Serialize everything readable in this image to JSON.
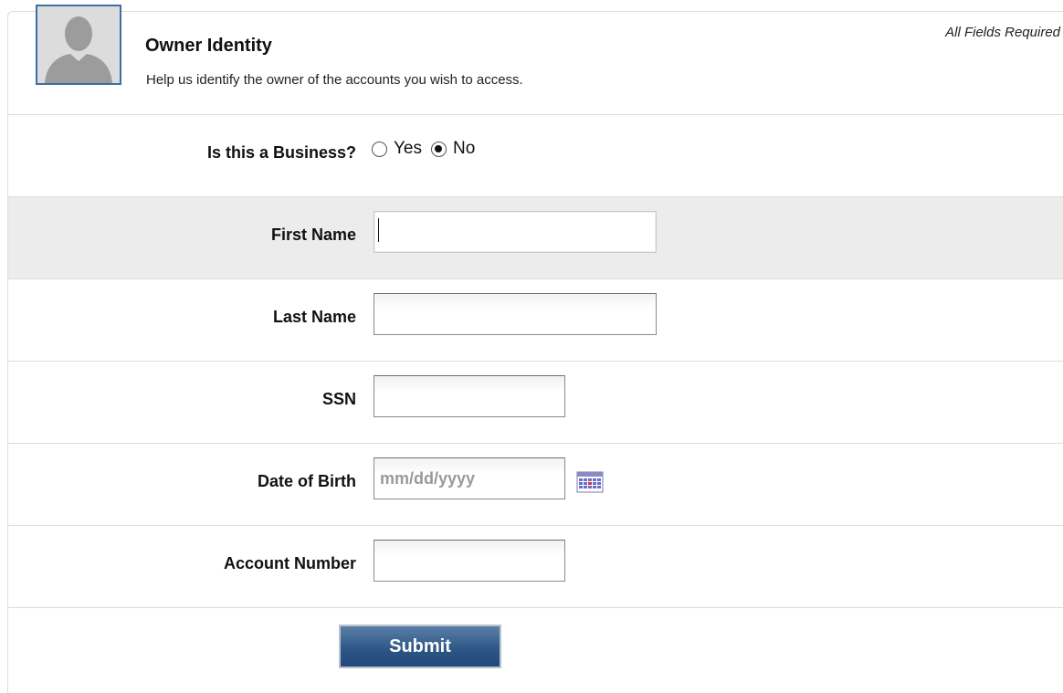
{
  "header": {
    "title": "Owner Identity",
    "subtitle": "Help us identify the owner of the accounts you wish to access.",
    "required_note": "All Fields Required",
    "avatar_icon": "user-silhouette-icon"
  },
  "business": {
    "label": "Is this a Business?",
    "options": [
      {
        "label": "Yes",
        "checked": false
      },
      {
        "label": "No",
        "checked": true
      }
    ]
  },
  "fields": {
    "first_name": {
      "label": "First Name",
      "value": "",
      "placeholder": ""
    },
    "last_name": {
      "label": "Last Name",
      "value": "",
      "placeholder": ""
    },
    "ssn": {
      "label": "SSN",
      "value": "",
      "placeholder": ""
    },
    "dob": {
      "label": "Date of Birth",
      "value": "",
      "placeholder": "mm/dd/yyyy",
      "icon": "calendar-icon"
    },
    "account_number": {
      "label": "Account Number",
      "value": "",
      "placeholder": ""
    }
  },
  "submit": {
    "label": "Submit"
  },
  "colors": {
    "accent": "#2c5585",
    "avatar_border": "#3d6ea5",
    "shaded_row": "#ececec"
  }
}
